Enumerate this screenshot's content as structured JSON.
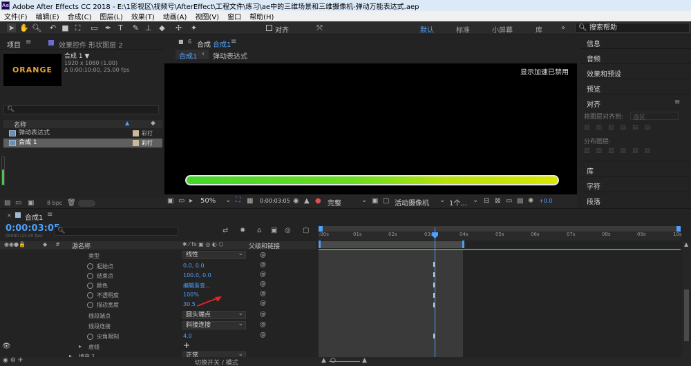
{
  "titlebar": {
    "app_icon": "Ae",
    "title": "Adobe After Effects CC 2018 - E:\\1影视区\\视频号\\AfterEffect\\工程文件\\练习\\ae中的三维场景和三维摄像机-弹动万能表达式.aep"
  },
  "menu": [
    "文件(F)",
    "编辑(E)",
    "合成(C)",
    "图层(L)",
    "效果(T)",
    "动画(A)",
    "视图(V)",
    "窗口",
    "帮助(H)"
  ],
  "toolbar": {
    "align_label": "对齐",
    "workspaces": [
      "默认",
      "标准",
      "小屏幕",
      "库"
    ],
    "search_placeholder": "搜索帮助"
  },
  "project": {
    "tab": "项目",
    "effects_tab": "效果控件 形状图层 2",
    "thumb_text": "ORANGE",
    "comp_name": "合成 1 ▼",
    "comp_size": "1920 x 1080 (1.00)",
    "comp_duration": "Δ 0:00:10:00, 25.00 fps",
    "col_name": "名称",
    "items": [
      {
        "name": "弹动表达式",
        "type": "彩打"
      },
      {
        "name": "合成 1",
        "type": "彩打"
      }
    ],
    "bpc": "8 bpc"
  },
  "composition": {
    "tab_label": "合成",
    "tab_name": "合成1",
    "breadcrumb_1": "合成1",
    "breadcrumb_2": "弹动表达式",
    "accel_notice": "显示加速已禁用",
    "zoom": "50%",
    "timecode": "0:00:03:05",
    "quality": "完整",
    "camera": "活动摄像机",
    "views": "1个...",
    "exposure": "+0.0"
  },
  "right_panel": {
    "items": [
      "信息",
      "音频",
      "效果和预设",
      "预览"
    ],
    "align_title": "对齐",
    "align_to_label": "将图层对齐到:",
    "align_to_value": "选区",
    "distribute_label": "分布图层:",
    "bottom_items": [
      "库",
      "字符",
      "段落"
    ]
  },
  "timeline": {
    "comp_tab": "合成1",
    "timecode": "0:00:03:05",
    "timecode_sub": "00080 (25.00 fps)",
    "col_source": "源名称",
    "col_parent": "父级和链接",
    "toggle_label": "切换开关 / 模式",
    "properties": [
      {
        "name": "类型",
        "value": "线性",
        "kind": "dropdown"
      },
      {
        "name": "起始点",
        "value": "0.0, 0.0",
        "kind": "value"
      },
      {
        "name": "结束点",
        "value": "100.0, 0.0",
        "kind": "value"
      },
      {
        "name": "颜色",
        "value": "编辑渐变...",
        "kind": "value"
      },
      {
        "name": "不透明度",
        "value": "100%",
        "kind": "value"
      },
      {
        "name": "描边宽度",
        "value": "30.5",
        "kind": "value"
      },
      {
        "name": "线段端点",
        "value": "圆头端点",
        "kind": "dropdown"
      },
      {
        "name": "线段连接",
        "value": "斜接连接",
        "kind": "dropdown"
      },
      {
        "name": "尖角限制",
        "value": "4.0",
        "kind": "value"
      },
      {
        "name": "虚线",
        "value": "+",
        "kind": "plus"
      },
      {
        "name": "填充 1",
        "value": "正常",
        "kind": "dropdown"
      }
    ],
    "ruler": [
      ":00s",
      "01s",
      "02s",
      "03s",
      "04s",
      "05s",
      "06s",
      "07s",
      "08s",
      "09s",
      "10s"
    ],
    "current_time_fraction": 0.32,
    "work_area_end_fraction": 0.4
  },
  "colors": {
    "accent_blue": "#4ea0ff",
    "bar_start": "#44d62c",
    "bar_end": "#d7e800",
    "annotation_arrow": "#e8231f",
    "title_orange": "#e8a23a"
  }
}
